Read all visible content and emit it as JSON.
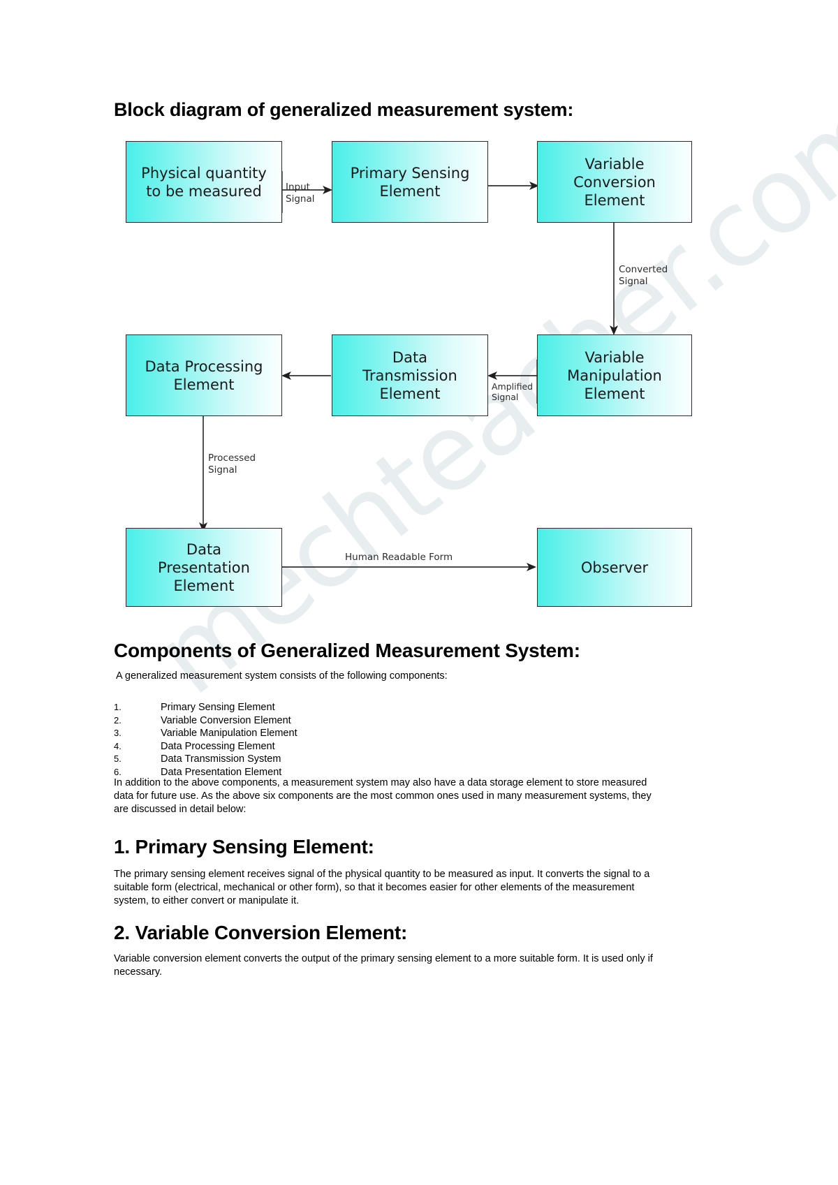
{
  "document": {
    "title_block_diagram": "Block diagram of generalized measurement system:",
    "heading_components": "Components of Generalized Measurement System:",
    "intro_line": "A generalized measurement system consists of the following components:",
    "addition_paragraph": "In addition to the above components, a measurement system may also have a data storage element to store measured data for future use. As the above six components are the most common ones used in many measurement systems, they are discussed in detail below:",
    "section1_heading": "1. Primary Sensing Element:",
    "section1_body": "The primary sensing element receives signal of the physical quantity to be measured as input. It converts the signal to a suitable form (electrical, mechanical or other form), so that it becomes easier for other elements of the measurement system, to either convert or manipulate it.",
    "section2_heading": "2. Variable Conversion Element:",
    "section2_body": "Variable conversion element converts the output of the primary sensing element to a more suitable form. It is used only if necessary.",
    "watermark": "mechteacher.com"
  },
  "components_list": [
    {
      "num": "1.",
      "label": "Primary Sensing Element"
    },
    {
      "num": "2.",
      "label": "Variable Conversion Element"
    },
    {
      "num": "3.",
      "label": "Variable Manipulation Element"
    },
    {
      "num": "4.",
      "label": "Data Processing Element"
    },
    {
      "num": "5.",
      "label": "Data Transmission System"
    },
    {
      "num": "6.",
      "label": "Data Presentation Element"
    }
  ],
  "diagram": {
    "blocks": {
      "physical_quantity": "Physical quantity\nto be measured",
      "primary_sensing": "Primary Sensing\nElement",
      "variable_conversion": "Variable\nConversion\nElement",
      "variable_manipulation": "Variable\nManipulation\nElement",
      "data_transmission": "Data\nTransmission\nElement",
      "data_processing": "Data Processing\nElement",
      "data_presentation": "Data\nPresentation\nElement",
      "observer": "Observer"
    },
    "edge_labels": {
      "input_signal": "Input\nSignal",
      "converted_signal": "Converted\nSignal",
      "amplified_signal": "Amplified\nSignal",
      "processed_signal": "Processed\nSignal",
      "human_readable_form": "Human Readable Form"
    },
    "colors": {
      "box_fill_start": "#4beee8",
      "box_fill_end": "#fbffff",
      "box_border": "#2b2b2b",
      "line": "#333333",
      "watermark": "#e8eef0"
    }
  }
}
